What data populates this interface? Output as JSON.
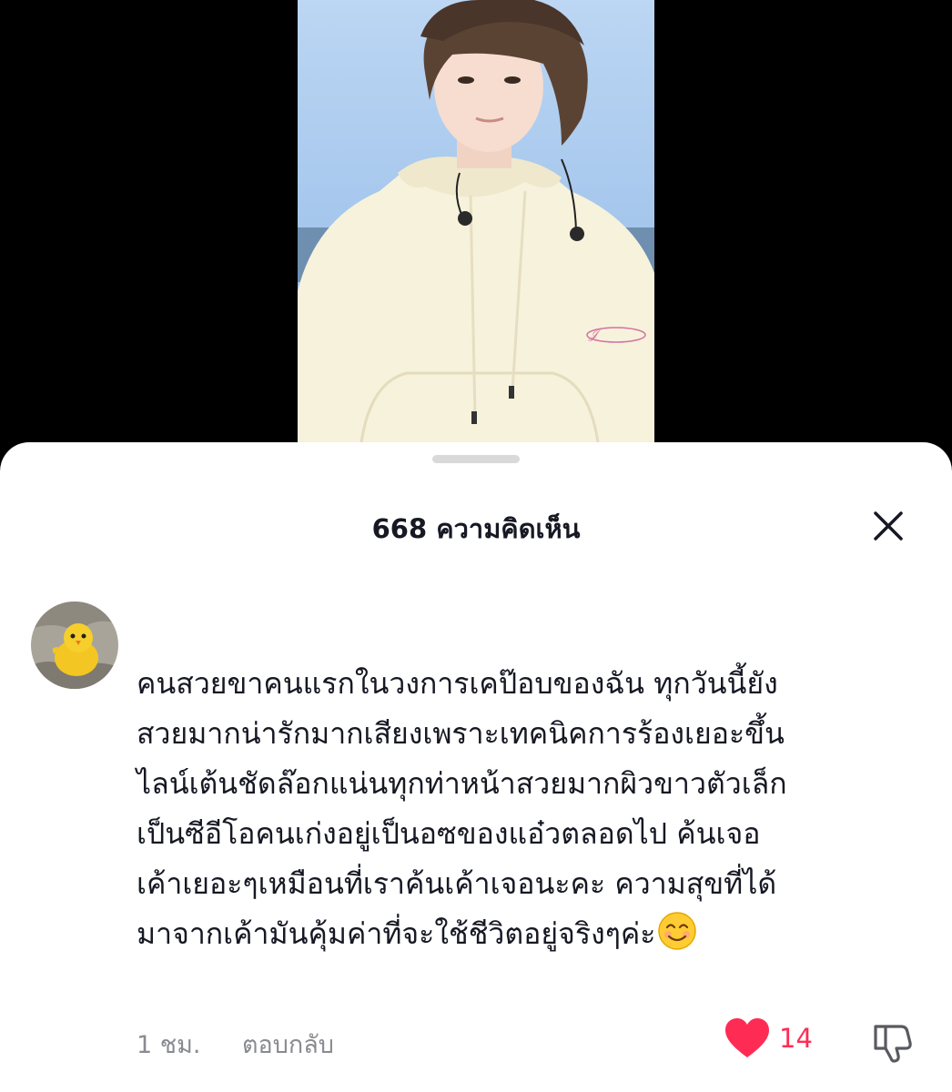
{
  "comments_panel": {
    "title": "668 ความคิดเห็น",
    "close_icon": "close-icon"
  },
  "comment": {
    "text": "คนสวยขาคนแรกในวงการเคป๊อบของฉัน ทุกวันนี้ยัง\nสวยมากน่ารักมากเสียงเพราะเทคนิคการร้องเยอะขึ้น\nไลน์เต้นชัดล๊อกแน่นทุกท่าหน้าสวยมากผิวขาวตัวเล็ก\nเป็นซีอีโอคนเก่งอยู่เป็นอซของแอ๋วตลอดไป ค้นเจอ\nเค้าเยอะๆเหมือนที่เราค้นเค้าเจอนะคะ ความสุขที่ได้\nมาจากเค้ามันคุ้มค่าที่จะใช้ชีวิตอยู่จริงๆค่ะ",
    "emoji": "smiling-face-emoji",
    "time": "1 ชม.",
    "reply_label": "ตอบกลับ",
    "like_count": "14",
    "liked": true,
    "like_color": "#fe2c55"
  }
}
